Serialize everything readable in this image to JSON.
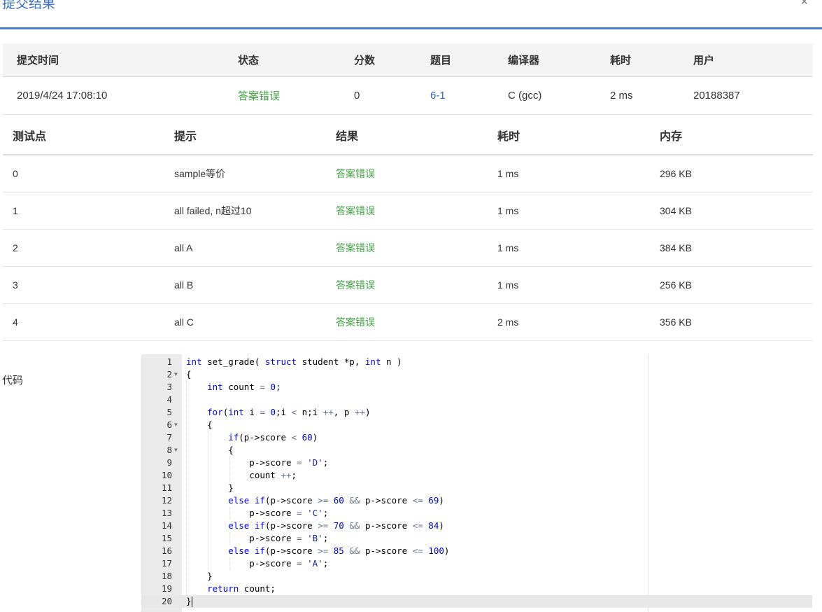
{
  "header": {
    "title": "提交结果",
    "close": "×"
  },
  "submission": {
    "headers": [
      "提交时间",
      "状态",
      "分数",
      "题目",
      "编译器",
      "耗时",
      "用户"
    ],
    "row": {
      "time": "2019/4/24 17:08:10",
      "status": "答案错误",
      "score": "0",
      "problem": "6-1",
      "compiler": "C (gcc)",
      "duration": "2 ms",
      "user": "20188387"
    }
  },
  "tests": {
    "headers": [
      "测试点",
      "提示",
      "结果",
      "耗时",
      "内存"
    ],
    "rows": [
      {
        "id": "0",
        "hint": "sample等价",
        "result": "答案错误",
        "time": "1 ms",
        "memory": "296 KB"
      },
      {
        "id": "1",
        "hint": "all failed, n超过10",
        "result": "答案错误",
        "time": "1 ms",
        "memory": "304 KB"
      },
      {
        "id": "2",
        "hint": "all A",
        "result": "答案错误",
        "time": "1 ms",
        "memory": "384 KB"
      },
      {
        "id": "3",
        "hint": "all B",
        "result": "答案错误",
        "time": "1 ms",
        "memory": "256 KB"
      },
      {
        "id": "4",
        "hint": "all C",
        "result": "答案错误",
        "time": "2 ms",
        "memory": "356 KB"
      }
    ]
  },
  "code": {
    "label": "代码",
    "lines": [
      "int set_grade( struct student *p, int n )",
      "{",
      "    int count = 0;",
      "",
      "    for(int i = 0;i < n;i ++, p ++)",
      "    {",
      "        if(p->score < 60)",
      "        {",
      "            p->score = 'D';",
      "            count ++;",
      "        }",
      "        else if(p->score >= 60 && p->score <= 69)",
      "            p->score = 'C';",
      "        else if(p->score >= 70 && p->score <= 84)",
      "            p->score = 'B';",
      "        else if(p->score >= 85 && p->score <= 100)",
      "            p->score = 'A';",
      "    }",
      "    return count;",
      "}"
    ],
    "fold_lines": [
      2,
      6,
      8
    ],
    "active_line": 20
  }
}
